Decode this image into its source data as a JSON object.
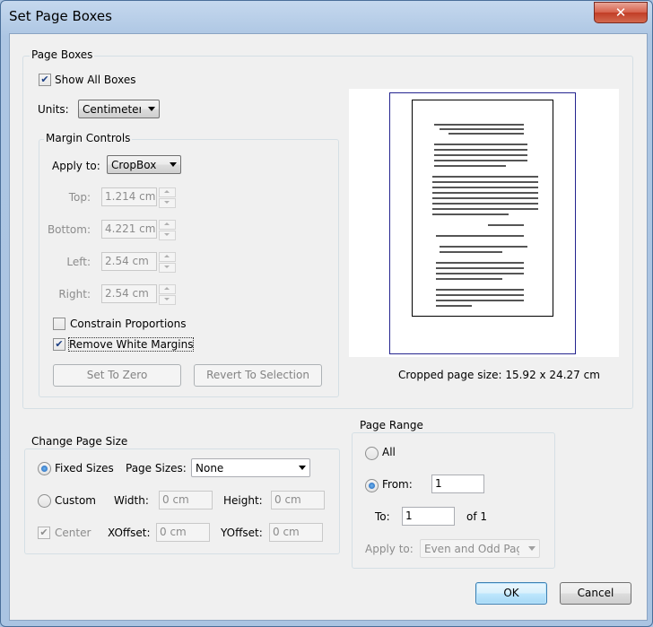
{
  "window": {
    "title": "Set Page Boxes",
    "close_glyph": "✕"
  },
  "page_boxes": {
    "legend": "Page Boxes",
    "show_all_boxes": {
      "label": "Show All Boxes",
      "checked": true
    },
    "units": {
      "label": "Units:",
      "value": "Centimeters"
    },
    "margin_controls": {
      "legend": "Margin Controls",
      "apply_to": {
        "label": "Apply to:",
        "value": "CropBox"
      },
      "top": {
        "label": "Top:",
        "value": "1.214 cm"
      },
      "bottom": {
        "label": "Bottom:",
        "value": "4.221 cm"
      },
      "left": {
        "label": "Left:",
        "value": "2.54 cm"
      },
      "right": {
        "label": "Right:",
        "value": "2.54 cm"
      },
      "constrain_proportions": {
        "label": "Constrain Proportions",
        "checked": false
      },
      "remove_white_margins": {
        "label": "Remove White Margins",
        "checked": true
      },
      "set_to_zero": "Set To Zero",
      "revert_to_selection": "Revert To Selection"
    },
    "cropped_size": "Cropped page size: 15.92 x 24.27 cm"
  },
  "change_page_size": {
    "legend": "Change Page Size",
    "fixed_sizes": {
      "label": "Fixed Sizes",
      "selected": true
    },
    "page_sizes": {
      "label": "Page Sizes:",
      "value": "None"
    },
    "custom": {
      "label": "Custom",
      "selected": false
    },
    "width": {
      "label": "Width:",
      "value": "0 cm"
    },
    "height": {
      "label": "Height:",
      "value": "0 cm"
    },
    "center": {
      "label": "Center",
      "checked": true
    },
    "xoffset": {
      "label": "XOffset:",
      "value": "0 cm"
    },
    "yoffset": {
      "label": "YOffset:",
      "value": "0 cm"
    }
  },
  "page_range": {
    "legend": "Page Range",
    "all": {
      "label": "All",
      "selected": false
    },
    "from": {
      "label": "From:",
      "value": "1",
      "selected": true
    },
    "to": {
      "label": "To:",
      "value": "1"
    },
    "of": "of 1",
    "apply_to": {
      "label": "Apply to:",
      "value": "Even and Odd Pages"
    }
  },
  "buttons": {
    "ok": "OK",
    "cancel": "Cancel"
  },
  "colors": {
    "accent": "#3c7fb1",
    "mediabox": "#25258f",
    "title_bar": "#aac4e2"
  }
}
